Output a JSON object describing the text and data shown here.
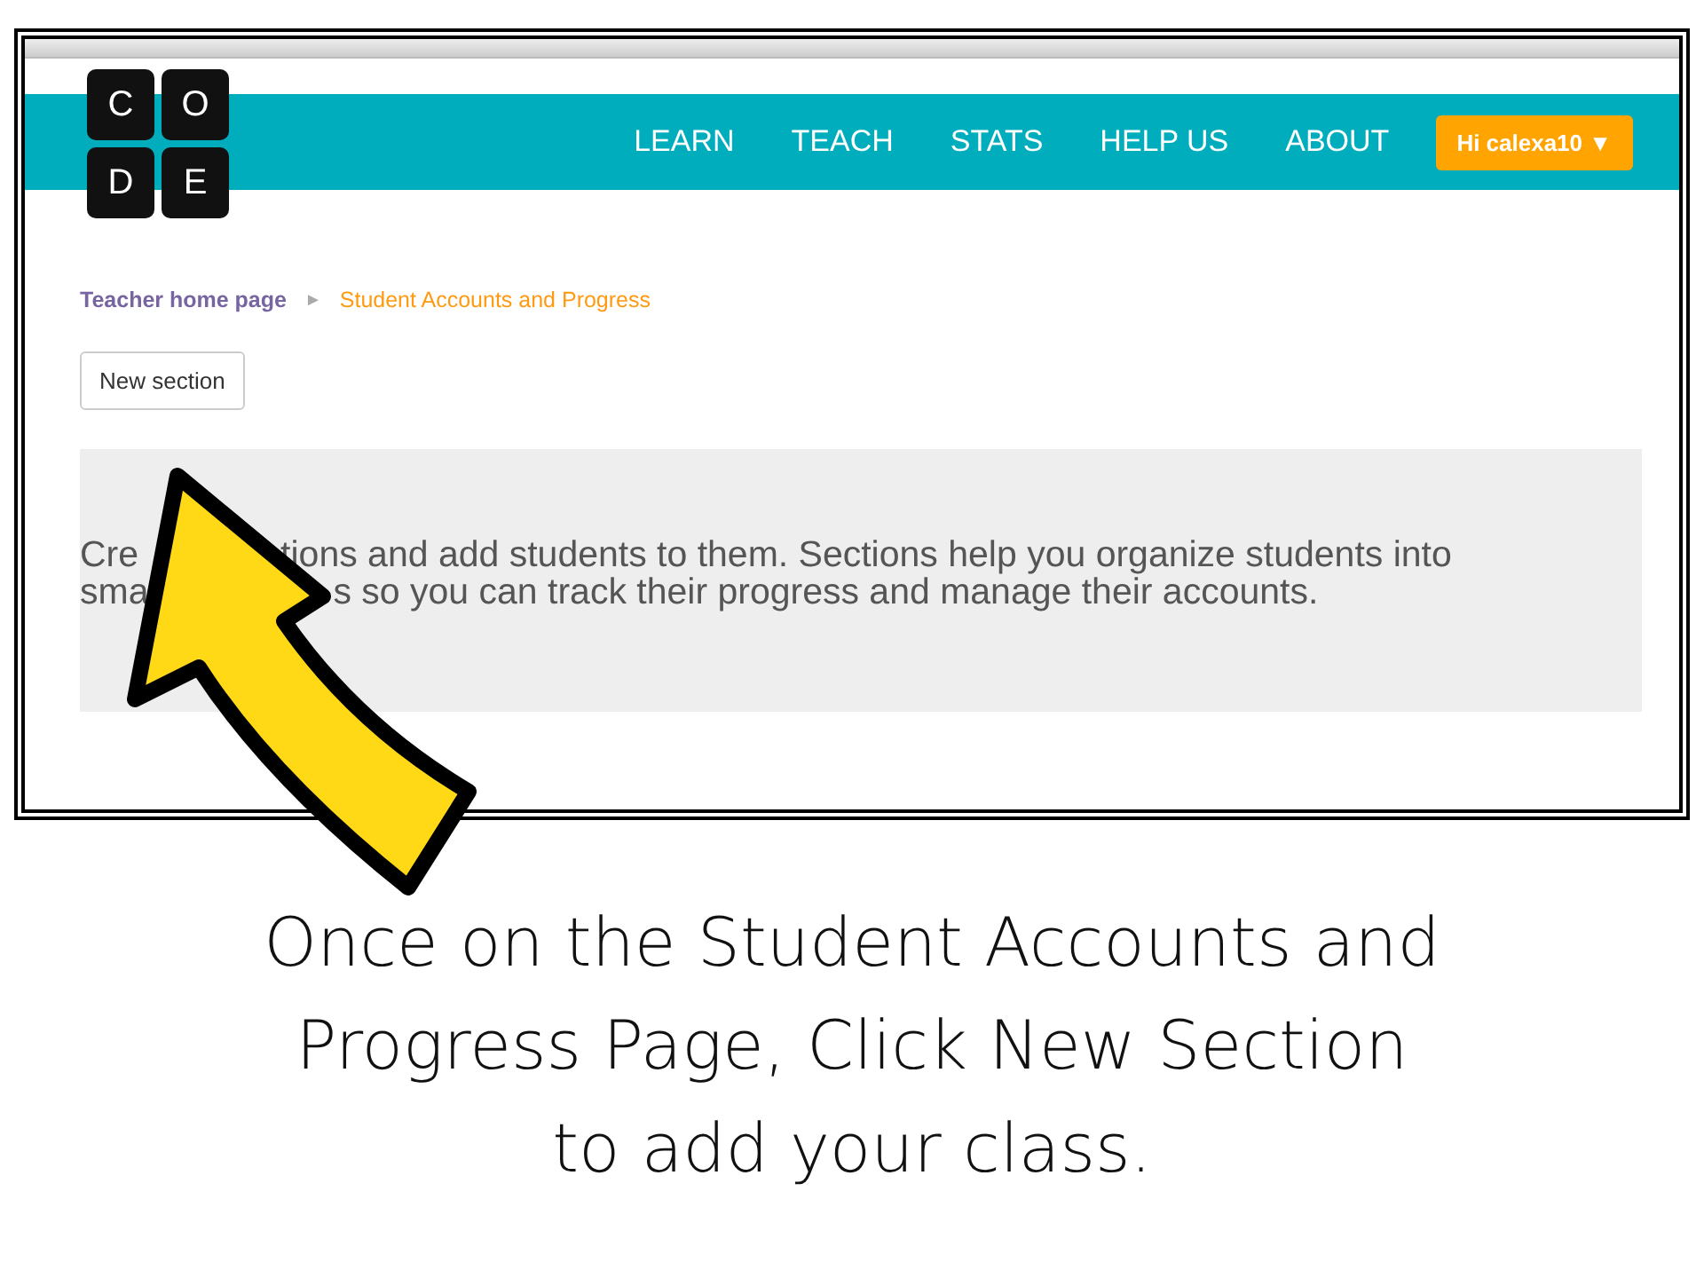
{
  "logo": {
    "letters": [
      "C",
      "O",
      "D",
      "E"
    ]
  },
  "nav": {
    "items": [
      "LEARN",
      "TEACH",
      "STATS",
      "HELP US",
      "ABOUT"
    ],
    "user_button": "Hi calexa10 ▼"
  },
  "breadcrumb": [
    {
      "label": "Teacher home page",
      "selected": false
    },
    {
      "label": "Student Accounts and Progress",
      "selected": true
    }
  ],
  "breadcrumb_separator": "►",
  "new_section_button": "New section",
  "info_panel": {
    "lines": [
      [
        "Cre",
        "tions and add students to them. Sections help you organize students into"
      ],
      [
        "sma",
        "s so you can track their progress and manage their accounts."
      ]
    ]
  },
  "caption": [
    "Once on the Student Accounts and",
    "Progress Page, Click New Section",
    "to add your class."
  ]
}
